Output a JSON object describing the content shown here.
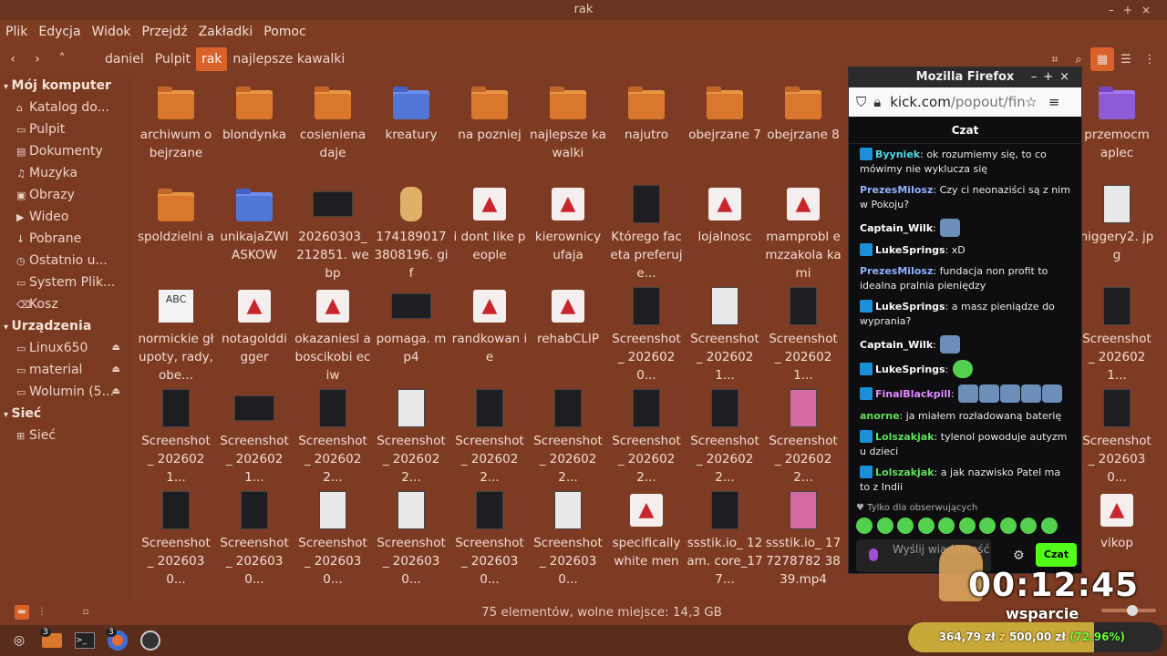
{
  "window": {
    "title": "rak"
  },
  "menu": [
    "Plik",
    "Edycja",
    "Widok",
    "Przejdź",
    "Zakładki",
    "Pomoc"
  ],
  "breadcrumbs": [
    {
      "label": "daniel"
    },
    {
      "label": "Pulpit"
    },
    {
      "label": "rak",
      "active": true
    },
    {
      "label": "najlepsze kawalki"
    }
  ],
  "sidebar": {
    "sections": [
      {
        "title": "Mój komputer",
        "items": [
          {
            "icon": "home-icon",
            "label": "Katalog do..."
          },
          {
            "icon": "folder-icon",
            "label": "Pulpit"
          },
          {
            "icon": "document-icon",
            "label": "Dokumenty"
          },
          {
            "icon": "music-icon",
            "label": "Muzyka"
          },
          {
            "icon": "image-icon",
            "label": "Obrazy"
          },
          {
            "icon": "video-icon",
            "label": "Wideo"
          },
          {
            "icon": "download-icon",
            "label": "Pobrane"
          },
          {
            "icon": "clock-icon",
            "label": "Ostatnio u..."
          },
          {
            "icon": "drive-icon",
            "label": "System Plik..."
          },
          {
            "icon": "trash-icon",
            "label": "Kosz"
          }
        ]
      },
      {
        "title": "Urządzenia",
        "items": [
          {
            "icon": "drive-icon",
            "label": "Linux650",
            "eject": true
          },
          {
            "icon": "drive-icon",
            "label": "material",
            "eject": true
          },
          {
            "icon": "drive-icon",
            "label": "Wolumin (5...",
            "eject": true
          }
        ]
      },
      {
        "title": "Sieć",
        "items": [
          {
            "icon": "network-icon",
            "label": "Sieć"
          }
        ]
      }
    ]
  },
  "files": [
    {
      "type": "folder",
      "label": "archiwum obejrzane"
    },
    {
      "type": "folder",
      "label": "blondynka"
    },
    {
      "type": "folder",
      "label": "cosieniena daje"
    },
    {
      "type": "folder-blue",
      "label": "kreatury"
    },
    {
      "type": "folder",
      "label": "na pozniej"
    },
    {
      "type": "folder",
      "label": "najlepsze kawalki"
    },
    {
      "type": "folder",
      "label": "najutro"
    },
    {
      "type": "folder",
      "label": "obejrzane 7"
    },
    {
      "type": "folder",
      "label": "obejrzane 8"
    },
    {
      "type": "hidden",
      "label": ""
    },
    {
      "type": "hidden",
      "label": ""
    },
    {
      "type": "hidden",
      "label": ""
    },
    {
      "type": "folder-purple",
      "label": "przemocm aplec"
    },
    {
      "type": "folder",
      "label": "spoldzielni a"
    },
    {
      "type": "folder-blue",
      "label": "unikajaZWI ASKOW"
    },
    {
      "type": "shot-wide",
      "label": "20260303_ 212851. webp"
    },
    {
      "type": "gif",
      "label": "174189017 3808196. gif"
    },
    {
      "type": "rocket",
      "label": "i dont like people"
    },
    {
      "type": "rocket",
      "label": "kierownicy ufaja"
    },
    {
      "type": "shot",
      "label": "Którego faceta preferuje..."
    },
    {
      "type": "rocket",
      "label": "lojalnosc"
    },
    {
      "type": "rocket",
      "label": "mamprobl emzzakola kami"
    },
    {
      "type": "hidden",
      "label": ""
    },
    {
      "type": "hidden",
      "label": ""
    },
    {
      "type": "hidden",
      "label": ""
    },
    {
      "type": "shot-light",
      "label": "niggery2. jpg"
    },
    {
      "type": "abc",
      "label": "normickie głupoty, rady, obe..."
    },
    {
      "type": "rocket",
      "label": "notagolddi gger"
    },
    {
      "type": "rocket",
      "label": "okazaniesl aboscikobi eciw"
    },
    {
      "type": "shot-wide",
      "label": "pomaga. mp4"
    },
    {
      "type": "rocket",
      "label": "randkowan ie"
    },
    {
      "type": "rocket",
      "label": "rehabCLIP"
    },
    {
      "type": "shot",
      "label": "Screenshot _ 2026020..."
    },
    {
      "type": "shot-light",
      "label": "Screenshot _ 2026021..."
    },
    {
      "type": "shot",
      "label": "Screenshot _ 2026021..."
    },
    {
      "type": "hidden",
      "label": ""
    },
    {
      "type": "hidden",
      "label": ""
    },
    {
      "type": "hidden",
      "label": ""
    },
    {
      "type": "shot",
      "label": "Screenshot _ 2026021..."
    },
    {
      "type": "shot",
      "label": "Screenshot _ 2026021..."
    },
    {
      "type": "shot-wide",
      "label": "Screenshot _ 2026021..."
    },
    {
      "type": "shot",
      "label": "Screenshot _ 2026022..."
    },
    {
      "type": "shot-light",
      "label": "Screenshot _ 2026022..."
    },
    {
      "type": "shot",
      "label": "Screenshot _ 2026022..."
    },
    {
      "type": "shot",
      "label": "Screenshot _ 2026022..."
    },
    {
      "type": "shot",
      "label": "Screenshot _ 2026022..."
    },
    {
      "type": "shot",
      "label": "Screenshot _ 2026022..."
    },
    {
      "type": "shot-pink",
      "label": "Screenshot _ 2026022..."
    },
    {
      "type": "hidden",
      "label": ""
    },
    {
      "type": "hidden",
      "label": ""
    },
    {
      "type": "hidden",
      "label": ""
    },
    {
      "type": "shot",
      "label": "Screenshot _ 2026030..."
    },
    {
      "type": "shot",
      "label": "Screenshot _ 2026030..."
    },
    {
      "type": "shot",
      "label": "Screenshot _ 2026030..."
    },
    {
      "type": "shot-light",
      "label": "Screenshot _ 2026030..."
    },
    {
      "type": "shot-light",
      "label": "Screenshot _ 2026030..."
    },
    {
      "type": "shot",
      "label": "Screenshot _ 2026030..."
    },
    {
      "type": "shot-light",
      "label": "Screenshot _ 2026030..."
    },
    {
      "type": "rocket",
      "label": "specifically white men"
    },
    {
      "type": "shot",
      "label": "ssstik.io_ 12am. core_177..."
    },
    {
      "type": "shot-pink",
      "label": "ssstik.io_ 177278782 3839.mp4"
    },
    {
      "type": "hidden",
      "label": ""
    },
    {
      "type": "hidden",
      "label": ""
    },
    {
      "type": "hidden",
      "label": ""
    },
    {
      "type": "rocket",
      "label": "vikop"
    }
  ],
  "status": {
    "text": "75 elementów, wolne miejsce: 14,3 GB"
  },
  "firefox": {
    "title": "Mozilla Firefox",
    "url_main": "kick.com",
    "url_rest": "/popout/fina",
    "chat_title": "Czat",
    "messages": [
      {
        "user": "Byyniek",
        "color": "#53d7e6",
        "badge": true,
        "text": "ok rozumiemy się, to co mówimy nie wyklucza się"
      },
      {
        "user": "PrezesMilosz",
        "color": "#8fb1ff",
        "badge": false,
        "text": "Czy ci neonaziści są z nim w Pokoju?"
      },
      {
        "user": "Captain_Wilk",
        "color": "#ffffff",
        "badge": false,
        "text": "",
        "emotes": 1
      },
      {
        "user": "LukeSprings",
        "color": "#f7f7f7",
        "badge": true,
        "text": "xD"
      },
      {
        "user": "PrezesMilosz",
        "color": "#8fb1ff",
        "badge": false,
        "text": "fundacja non profit to idealna pralnia pieniędzy"
      },
      {
        "user": "LukeSprings",
        "color": "#f7f7f7",
        "badge": true,
        "text": "a masz pieniądze do wyprania?"
      },
      {
        "user": "Captain_Wilk",
        "color": "#ffffff",
        "badge": false,
        "text": "",
        "emotes": 1
      },
      {
        "user": "LukeSprings",
        "color": "#f7f7f7",
        "badge": true,
        "text": "",
        "emotes": 1
      },
      {
        "user": "FinalBlackpill",
        "color": "#e089ff",
        "badge": true,
        "text": "",
        "emotes": 5
      },
      {
        "user": "anorne",
        "color": "#5fe05b",
        "badge": false,
        "text": "ja miałem rozładowaną baterię"
      },
      {
        "user": "Lolszakjak",
        "color": "#5fe05b",
        "badge": true,
        "text": "tylenol powoduje autyzm u dzieci"
      },
      {
        "user": "Lolszakjak",
        "color": "#5fe05b",
        "badge": true,
        "text": "a jak nazwisko Patel ma to z Indii"
      }
    ],
    "followers_only": "Tylko dla obserwujących",
    "input_placeholder": "Wyślij wiadomość",
    "send_label": "Czat"
  },
  "overlay": {
    "timer": "00:12:45",
    "support_label": "wsparcie",
    "goal_current": "364,79 zł",
    "goal_sep": "z",
    "goal_total": "500,00 zł",
    "goal_percent": "(72.96%)",
    "goal_fraction": 0.7296
  }
}
